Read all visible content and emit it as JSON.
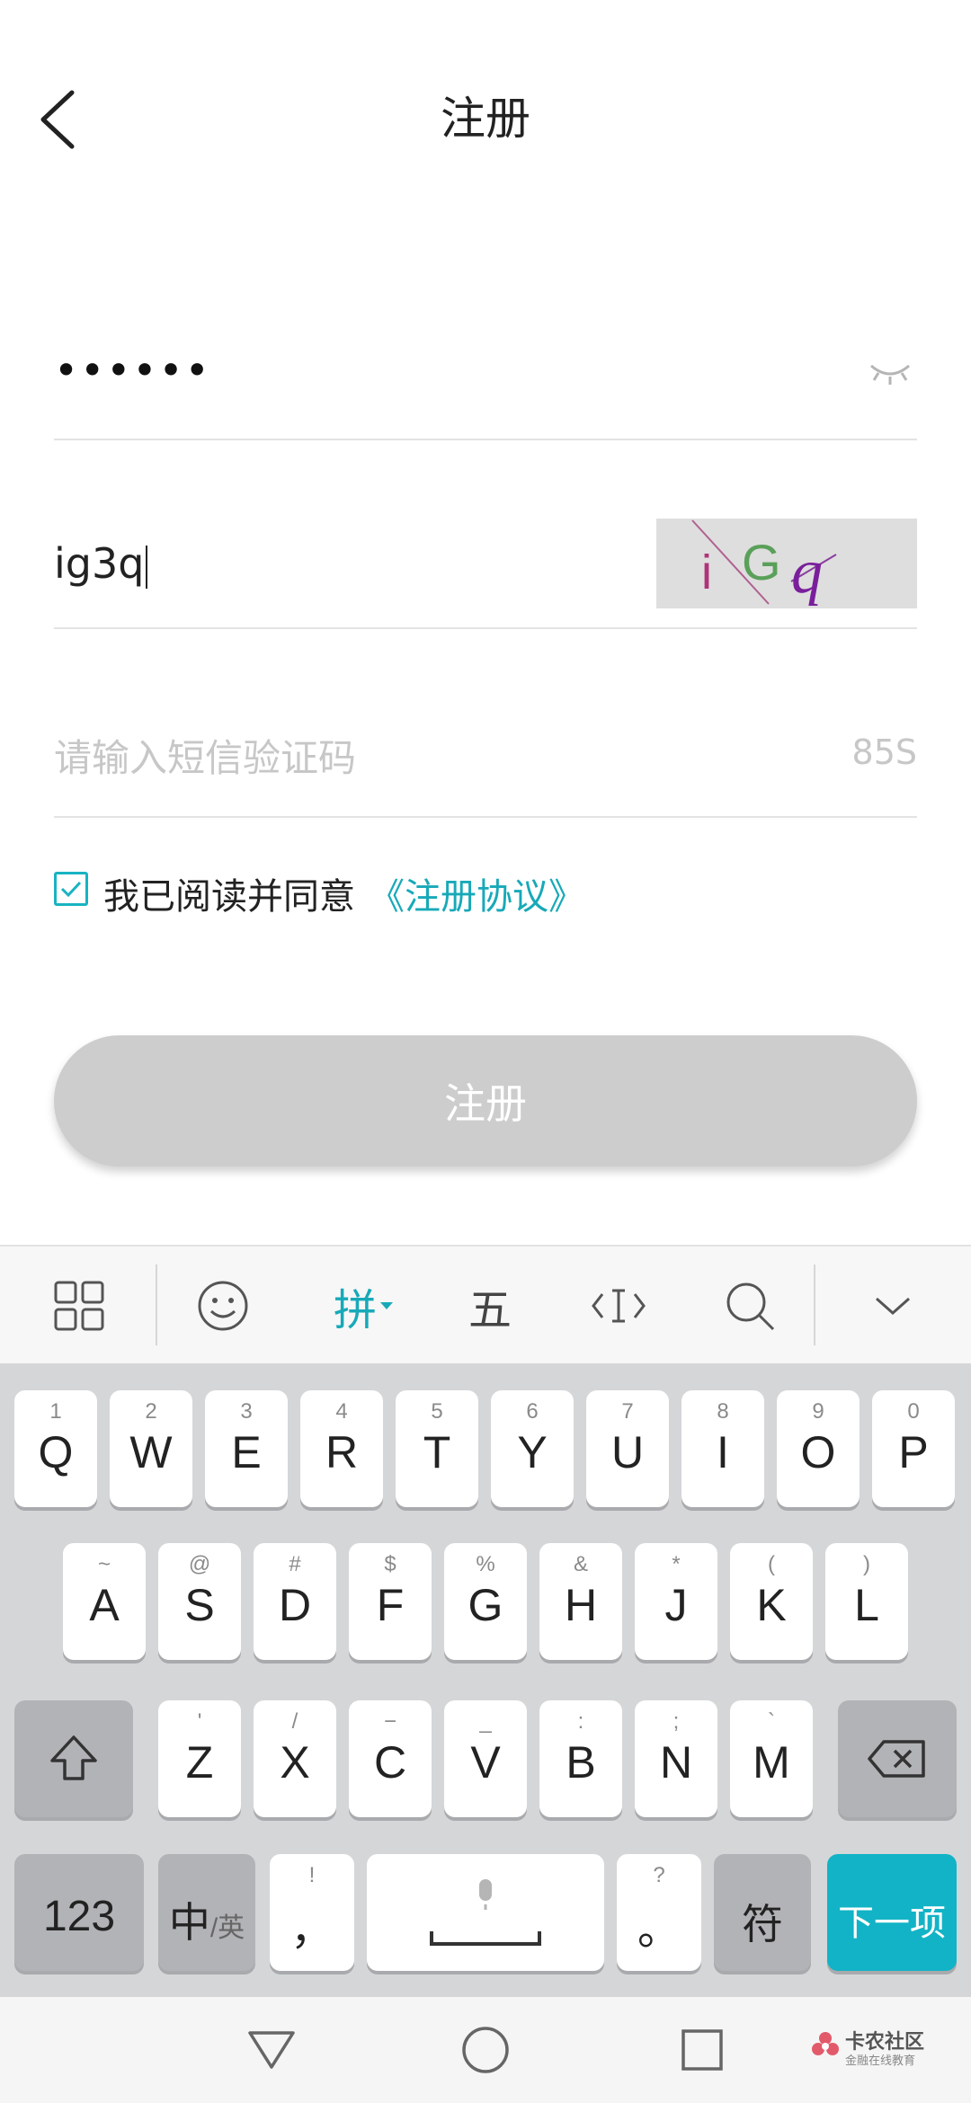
{
  "header": {
    "title": "注册"
  },
  "password_field": {
    "value": "••••••"
  },
  "captcha_field": {
    "value": "ig3q",
    "image_text": "iGq"
  },
  "sms_field": {
    "placeholder": "请输入短信验证码",
    "countdown": "85S"
  },
  "agreement": {
    "checked": true,
    "text": "我已阅读并同意",
    "link": "《注册协议》"
  },
  "register_button": {
    "label": "注册"
  },
  "keyboard_toolbar": {
    "items": [
      "grid-icon",
      "emoji-icon",
      "拼",
      "五",
      "cursor-icon",
      "search-icon",
      "collapse-icon"
    ]
  },
  "keyboard": {
    "row1": [
      {
        "key": "Q",
        "sub": "1"
      },
      {
        "key": "W",
        "sub": "2"
      },
      {
        "key": "E",
        "sub": "3"
      },
      {
        "key": "R",
        "sub": "4"
      },
      {
        "key": "T",
        "sub": "5"
      },
      {
        "key": "Y",
        "sub": "6"
      },
      {
        "key": "U",
        "sub": "7"
      },
      {
        "key": "I",
        "sub": "8"
      },
      {
        "key": "O",
        "sub": "9"
      },
      {
        "key": "P",
        "sub": "0"
      }
    ],
    "row2": [
      {
        "key": "A",
        "sub": "~"
      },
      {
        "key": "S",
        "sub": "@"
      },
      {
        "key": "D",
        "sub": "#"
      },
      {
        "key": "F",
        "sub": "$"
      },
      {
        "key": "G",
        "sub": "%"
      },
      {
        "key": "H",
        "sub": "&"
      },
      {
        "key": "J",
        "sub": "*"
      },
      {
        "key": "K",
        "sub": "("
      },
      {
        "key": "L",
        "sub": ")"
      }
    ],
    "row3": [
      {
        "key": "Z",
        "sub": "'"
      },
      {
        "key": "X",
        "sub": "/"
      },
      {
        "key": "C",
        "sub": "−"
      },
      {
        "key": "V",
        "sub": "_"
      },
      {
        "key": "B",
        "sub": ":"
      },
      {
        "key": "N",
        "sub": ";"
      },
      {
        "key": "M",
        "sub": "`"
      }
    ],
    "row4": {
      "num": "123",
      "lang_main": "中",
      "lang_sub": "/英",
      "comma_sub": "!",
      "comma": "，",
      "period_sub": "?",
      "period": "。",
      "symbol": "符",
      "next": "下一项"
    }
  },
  "watermark": {
    "text": "卡农社区",
    "sub": "金融在线教育"
  },
  "colors": {
    "accent": "#18b3c2",
    "button_disabled": "#cdcdcd",
    "keyboard_bg": "#d5d6d8"
  }
}
